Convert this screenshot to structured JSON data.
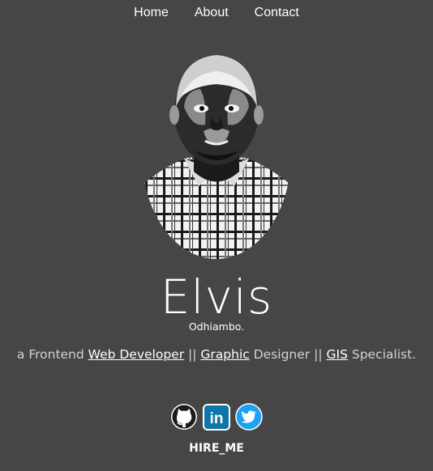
{
  "nav": {
    "items": [
      {
        "label": "Home"
      },
      {
        "label": "About"
      },
      {
        "label": "Contact"
      }
    ]
  },
  "profile": {
    "first_name": "Elvis",
    "last_name": "Odhiambo."
  },
  "tagline": {
    "prefix": "a Frontend",
    "web_developer": "Web Developer",
    "sep1": "||",
    "graphic": "Graphic",
    "designer": "Designer",
    "sep2": "||",
    "gis": "GIS",
    "specialist": "Specialist."
  },
  "socials": [
    {
      "icon": "github-icon"
    },
    {
      "icon": "linkedin-icon",
      "text": "in",
      "color": "#0e76a8"
    },
    {
      "icon": "twitter-icon",
      "color": "#1da1f2"
    }
  ],
  "cta": {
    "label": "HIRE_ME"
  },
  "colors": {
    "background": "#464646",
    "text": "#ececec"
  }
}
